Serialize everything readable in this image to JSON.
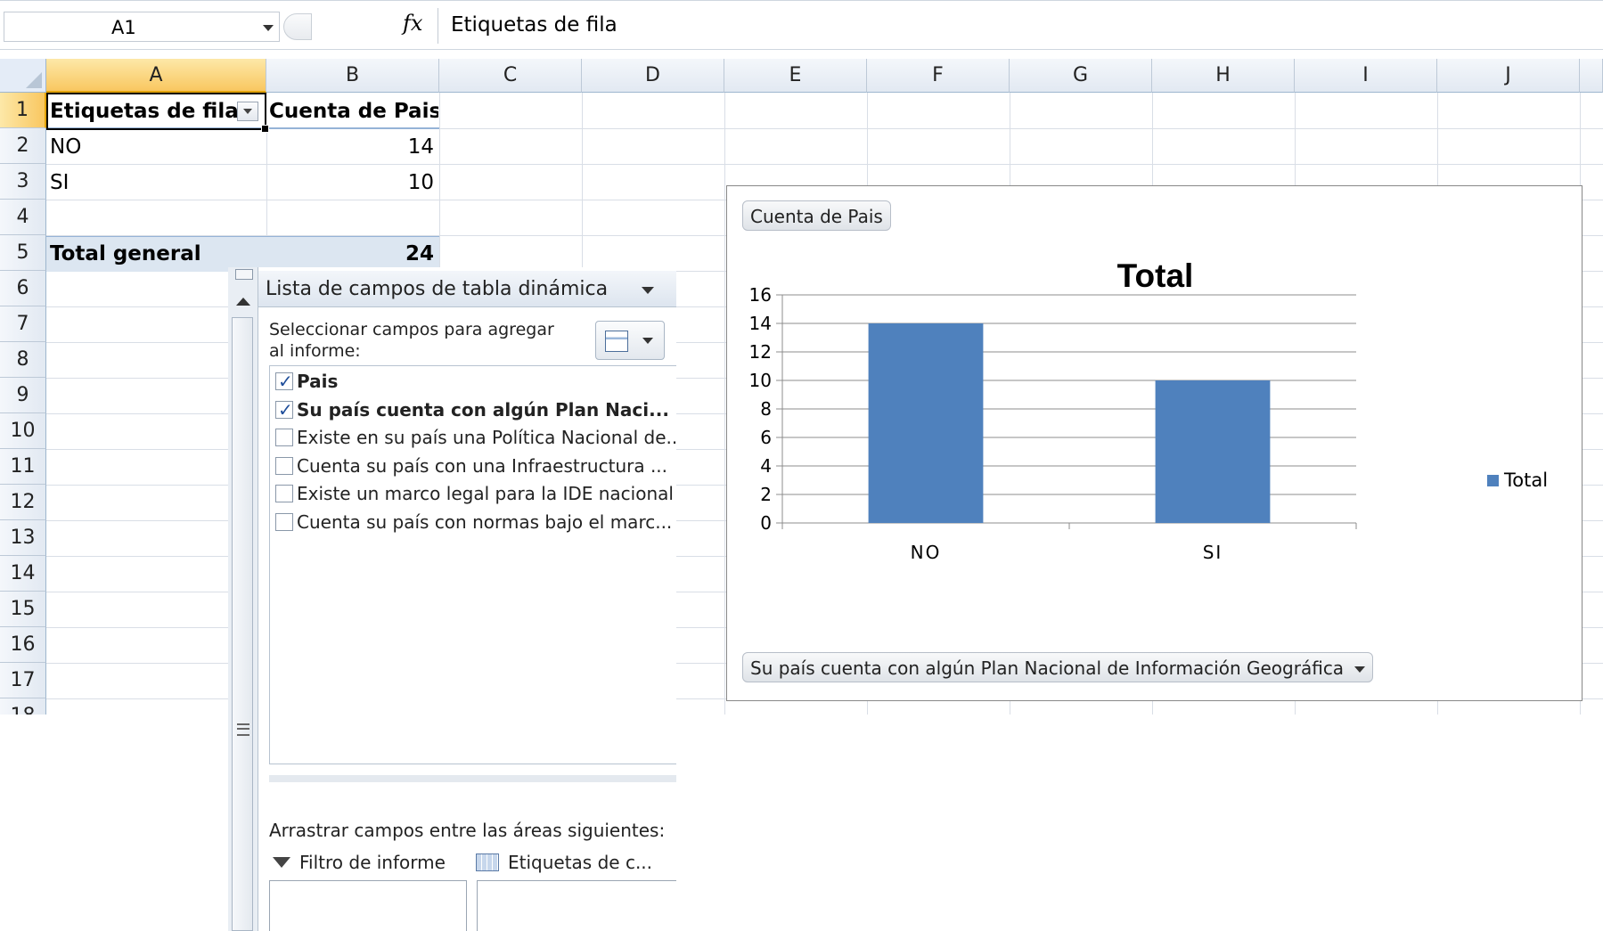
{
  "formula_bar": {
    "name_box": "A1",
    "fx_symbol": "fx",
    "value": "Etiquetas de fila"
  },
  "columns": [
    "A",
    "B",
    "C",
    "D",
    "E",
    "F",
    "G",
    "H",
    "I",
    "J"
  ],
  "rows": [
    "1",
    "2",
    "3",
    "4",
    "5",
    "6",
    "7",
    "8",
    "9",
    "10",
    "11",
    "12",
    "13",
    "14",
    "15",
    "16",
    "17",
    "18"
  ],
  "pivot": {
    "header_row_label": "Etiquetas de fila",
    "header_value_label": "Cuenta de Pais",
    "rows": [
      {
        "label": "NO",
        "value": "14"
      },
      {
        "label": "SI",
        "value": "10"
      }
    ],
    "total_label": "Total general",
    "total_value": "24"
  },
  "chart_data": {
    "type": "bar",
    "title": "Total",
    "categories": [
      "NO",
      "SI"
    ],
    "series": [
      {
        "name": "Total",
        "values": [
          14,
          10
        ],
        "color": "#4f81bd"
      }
    ],
    "ylim": [
      0,
      16
    ],
    "yticks": [
      0,
      2,
      4,
      6,
      8,
      10,
      12,
      14,
      16
    ],
    "grid": true,
    "legend": "right",
    "value_field_button": "Cuenta de Pais",
    "axis_field_button": "Su país cuenta con algún Plan Nacional de Información Geográfica"
  },
  "field_list": {
    "title": "Lista de campos de tabla dinámica",
    "instructions": "Seleccionar campos para agregar al informe:",
    "fields": [
      {
        "label": "Pais",
        "checked": true
      },
      {
        "label": "Su país cuenta con algún Plan Naci...",
        "checked": true
      },
      {
        "label": "Existe en su país una Política Nacional de...",
        "checked": false
      },
      {
        "label": "Cuenta su país con una Infraestructura ...",
        "checked": false
      },
      {
        "label": "Existe un marco legal para la IDE nacional",
        "checked": false
      },
      {
        "label": "Cuenta su país con normas bajo el marc...",
        "checked": false
      }
    ],
    "areas_text": "Arrastrar campos entre las áreas siguientes:",
    "report_filter_label": "Filtro de informe",
    "column_labels_label": "Etiquetas de c..."
  },
  "colors": {
    "accent": "#4f81bd",
    "selected_header": "#f9c760",
    "pivot_total_bg": "#dce6f1"
  }
}
